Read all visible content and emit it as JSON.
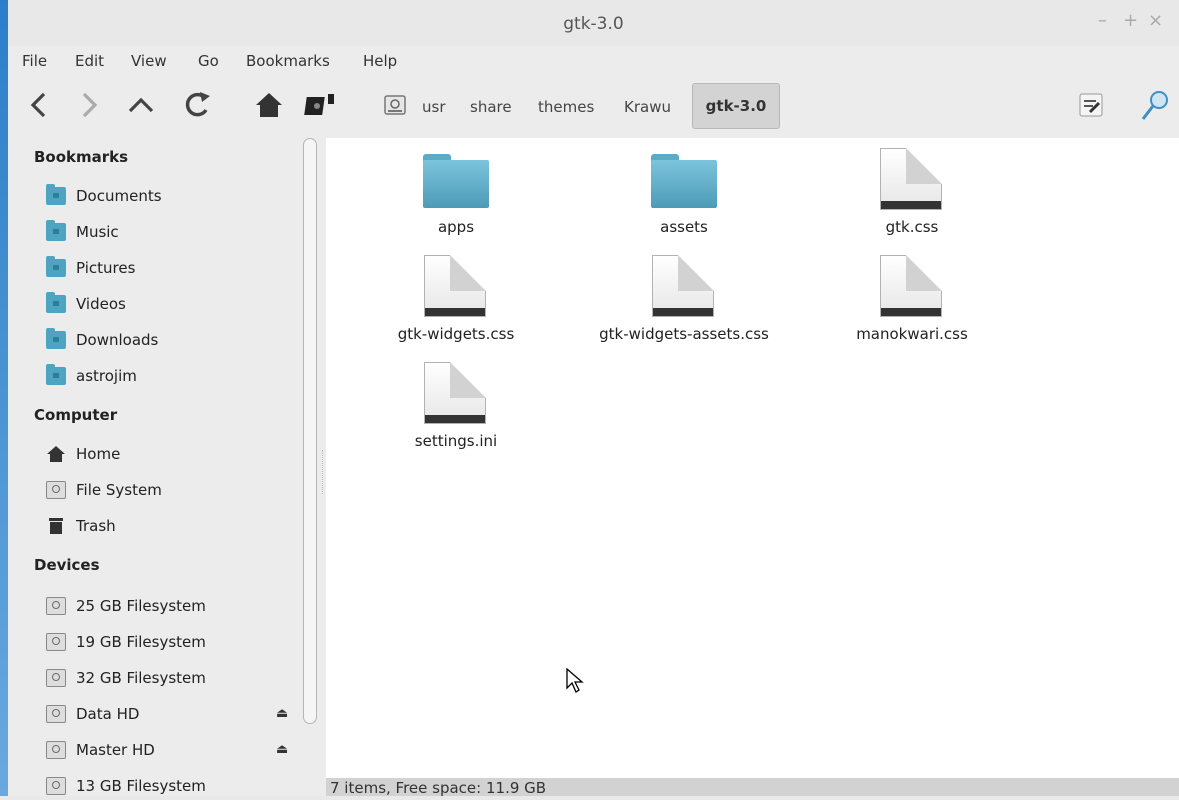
{
  "window": {
    "title": "gtk-3.0",
    "controls": {
      "minimize": "–",
      "maximize": "+",
      "close": "×"
    }
  },
  "menu": {
    "items": [
      "File",
      "Edit",
      "View",
      "Go",
      "Bookmarks",
      "Help"
    ]
  },
  "toolbar": {
    "icons": [
      "back-icon",
      "forward-icon",
      "up-icon",
      "reload-icon",
      "home-icon",
      "drive-icon",
      "disk-icon",
      "notes-icon",
      "search-icon"
    ],
    "breadcrumbs": [
      "usr",
      "share",
      "themes",
      "Krawu",
      "gtk-3.0"
    ]
  },
  "sidebar": {
    "bookmarks_title": "Bookmarks",
    "bookmarks": [
      "Documents",
      "Music",
      "Pictures",
      "Videos",
      "Downloads",
      "astrojim"
    ],
    "computer_title": "Computer",
    "computer": [
      "Home",
      "File System",
      "Trash"
    ],
    "devices_title": "Devices",
    "devices": [
      "25 GB Filesystem",
      "19 GB Filesystem",
      "32 GB Filesystem",
      "Data HD",
      "Master HD",
      "13 GB Filesystem"
    ],
    "eject_glyph": "⏏"
  },
  "files": [
    "apps",
    "assets",
    "gtk.css",
    "gtk-widgets.css",
    "gtk-widgets-assets.css",
    "manokwari.css",
    "settings.ini"
  ],
  "status": "7 items, Free space: 11.9 GB"
}
